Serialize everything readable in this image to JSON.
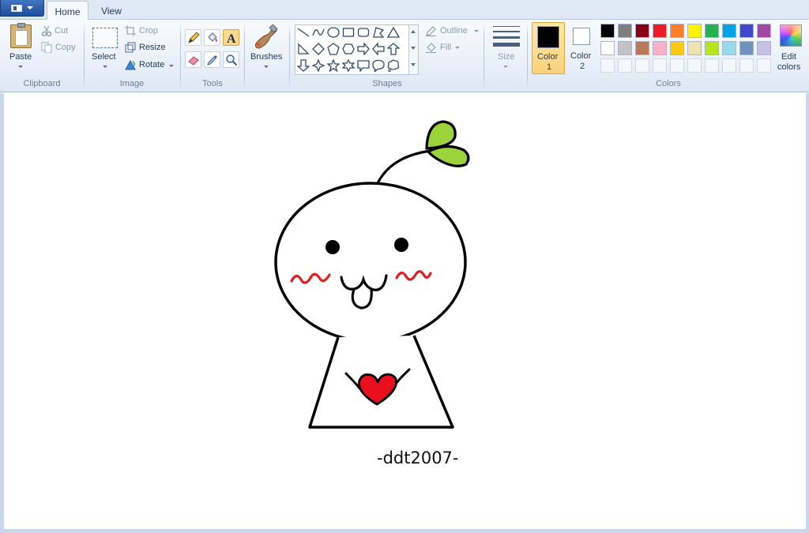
{
  "tabs": {
    "home": "Home",
    "view": "View"
  },
  "clipboard": {
    "paste": "Paste",
    "cut": "Cut",
    "copy": "Copy",
    "group": "Clipboard"
  },
  "image": {
    "select": "Select",
    "crop": "Crop",
    "resize": "Resize",
    "rotate": "Rotate",
    "group": "Image"
  },
  "tools": {
    "group": "Tools",
    "active": "text-tool"
  },
  "brushes": {
    "label": "Brushes"
  },
  "shapes": {
    "outline": "Outline",
    "fill": "Fill",
    "group": "Shapes"
  },
  "size": {
    "label": "Size"
  },
  "colors": {
    "color1_label": "Color",
    "color1_num": "1",
    "color2_label": "Color",
    "color2_num": "2",
    "color1_value": "#000000",
    "color2_value": "#ffffff",
    "edit_label_1": "Edit",
    "edit_label_2": "colors",
    "group": "Colors",
    "palette_row1": [
      "#000000",
      "#7f7f7f",
      "#880015",
      "#ed1c24",
      "#ff7f27",
      "#fff200",
      "#22b14c",
      "#00a2e8",
      "#3f48cc",
      "#a349a4"
    ],
    "palette_row2": [
      "#ffffff",
      "#c3c3c3",
      "#b97a57",
      "#ffaec9",
      "#ffc90e",
      "#efe4b0",
      "#b5e61d",
      "#99d9ea",
      "#7092be",
      "#c8bfe7"
    ]
  },
  "canvas": {
    "signature": "-ddt2007-",
    "stroke_color": "#000000",
    "blush_color": "#e02020",
    "heart_color": "#e8101c",
    "leaf_color": "#9ad33a"
  }
}
